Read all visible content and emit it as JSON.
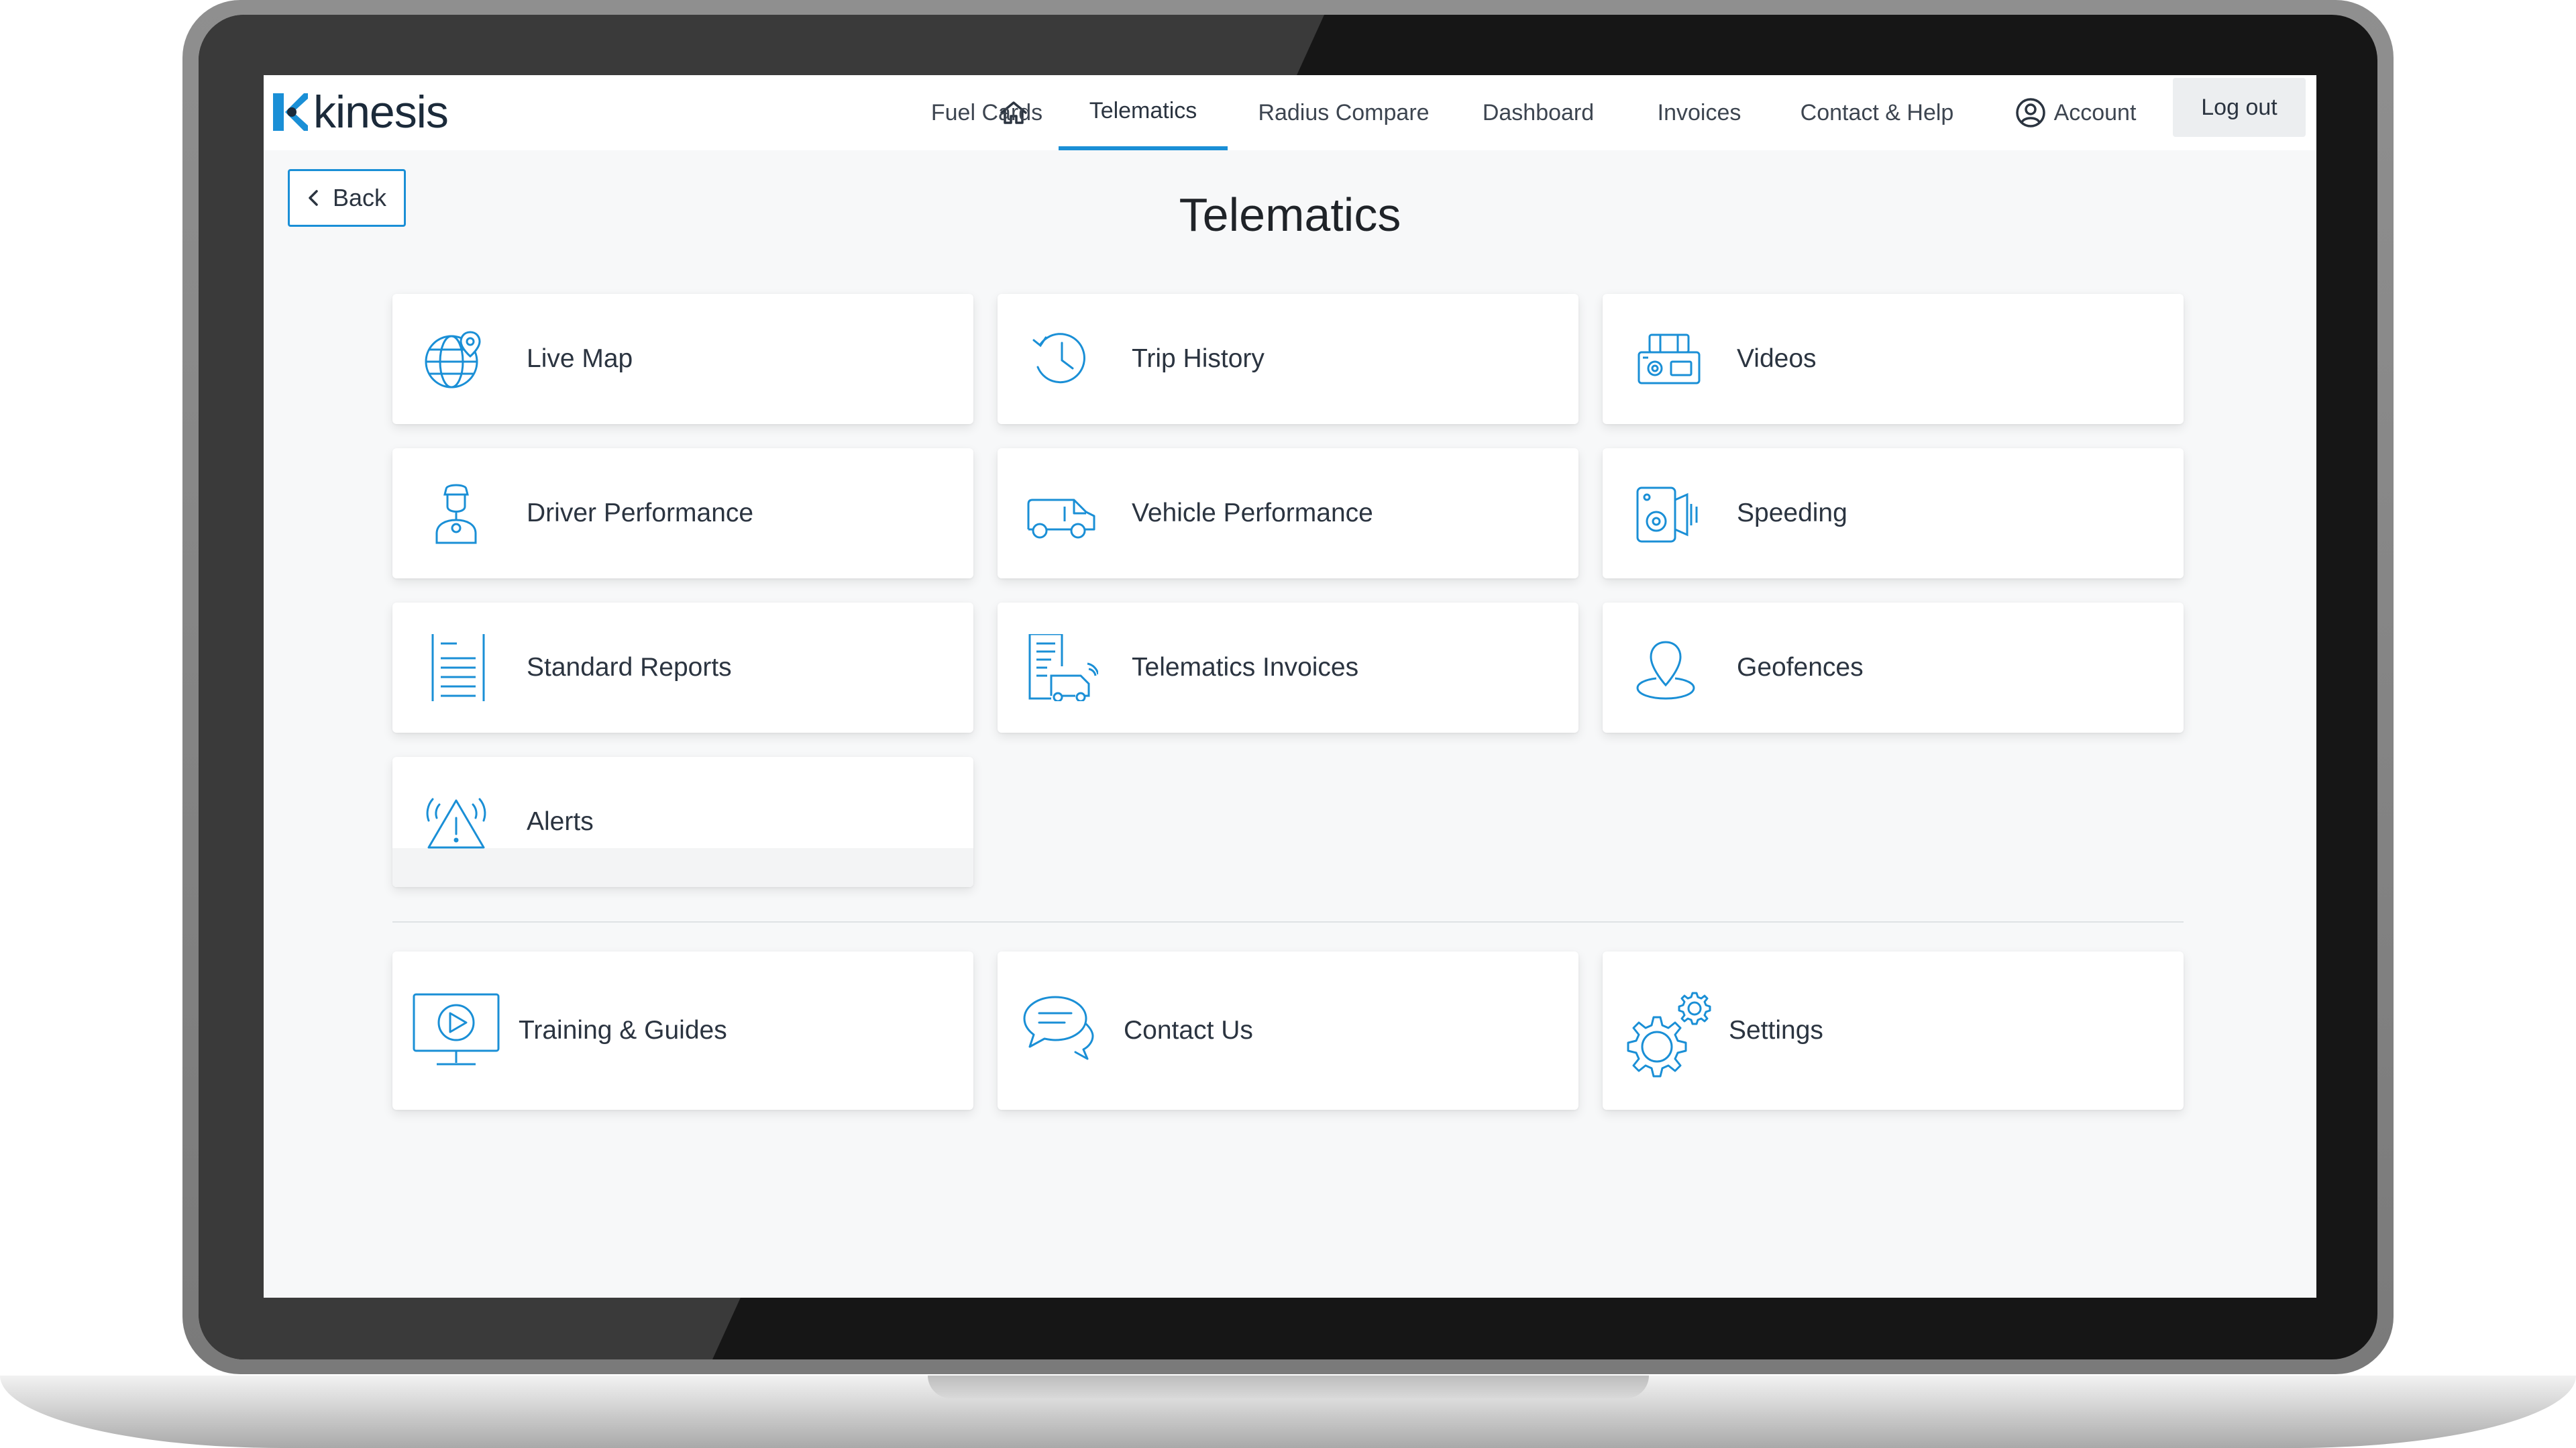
{
  "brand": {
    "name": "kinesis",
    "accent": "#1a8fd6"
  },
  "nav": {
    "home_icon": "home-icon",
    "items": [
      {
        "label": "Fuel Cards"
      },
      {
        "label": "Telematics",
        "active": true
      },
      {
        "label": "Radius Compare"
      },
      {
        "label": "Dashboard"
      },
      {
        "label": "Invoices"
      },
      {
        "label": "Contact & Help"
      }
    ],
    "account": {
      "label": "Account",
      "icon": "user-circle-icon"
    },
    "logout": {
      "label": "Log out"
    }
  },
  "back": {
    "label": "Back"
  },
  "page": {
    "title": "Telematics"
  },
  "tiles": [
    {
      "label": "Live Map",
      "icon": "globe-pin-icon"
    },
    {
      "label": "Trip History",
      "icon": "history-clock-icon"
    },
    {
      "label": "Videos",
      "icon": "dashcam-icon"
    },
    {
      "label": "Driver Performance",
      "icon": "driver-icon"
    },
    {
      "label": "Vehicle Performance",
      "icon": "van-icon"
    },
    {
      "label": "Speeding",
      "icon": "speed-camera-icon"
    },
    {
      "label": "Standard Reports",
      "icon": "report-document-icon"
    },
    {
      "label": "Telematics Invoices",
      "icon": "invoice-van-icon"
    },
    {
      "label": "Geofences",
      "icon": "geofence-pin-icon"
    },
    {
      "label": "Alerts",
      "icon": "alert-triangle-icon"
    }
  ],
  "support_tiles": [
    {
      "label": "Training & Guides",
      "icon": "video-monitor-icon"
    },
    {
      "label": "Contact Us",
      "icon": "chat-bubbles-icon"
    },
    {
      "label": "Settings",
      "icon": "gears-icon"
    }
  ]
}
